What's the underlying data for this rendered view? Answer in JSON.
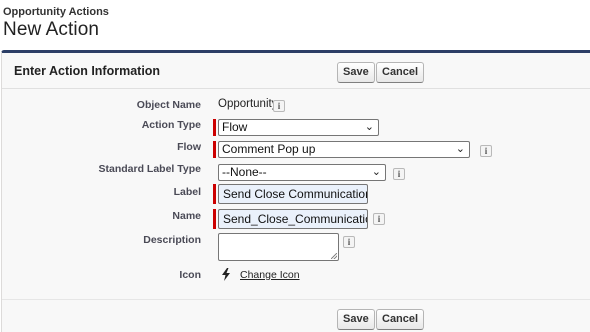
{
  "header": {
    "subtitle": "Opportunity Actions",
    "title": "New Action"
  },
  "block": {
    "title": "Enter Action Information",
    "save_label": "Save",
    "cancel_label": "Cancel"
  },
  "form": {
    "object_name_label": "Object Name",
    "object_name_value": "Opportunity",
    "action_type_label": "Action Type",
    "action_type_value": "Flow",
    "flow_label": "Flow",
    "flow_value": "Comment Pop up",
    "standard_label_type_label": "Standard Label Type",
    "standard_label_type_value": "--None--",
    "label_label": "Label",
    "label_value": "Send Close Communication",
    "name_label": "Name",
    "name_value": "Send_Close_Communication",
    "description_label": "Description",
    "description_value": "",
    "icon_label": "Icon",
    "change_icon_label": "Change Icon"
  },
  "icons": {
    "info": "info-icon",
    "chevron": "chevron-down-icon",
    "action": "lightning-bolt-icon"
  },
  "colors": {
    "required": "#cc0000",
    "header_border": "#2c3e66",
    "field_fill": "#eaf1fb"
  }
}
